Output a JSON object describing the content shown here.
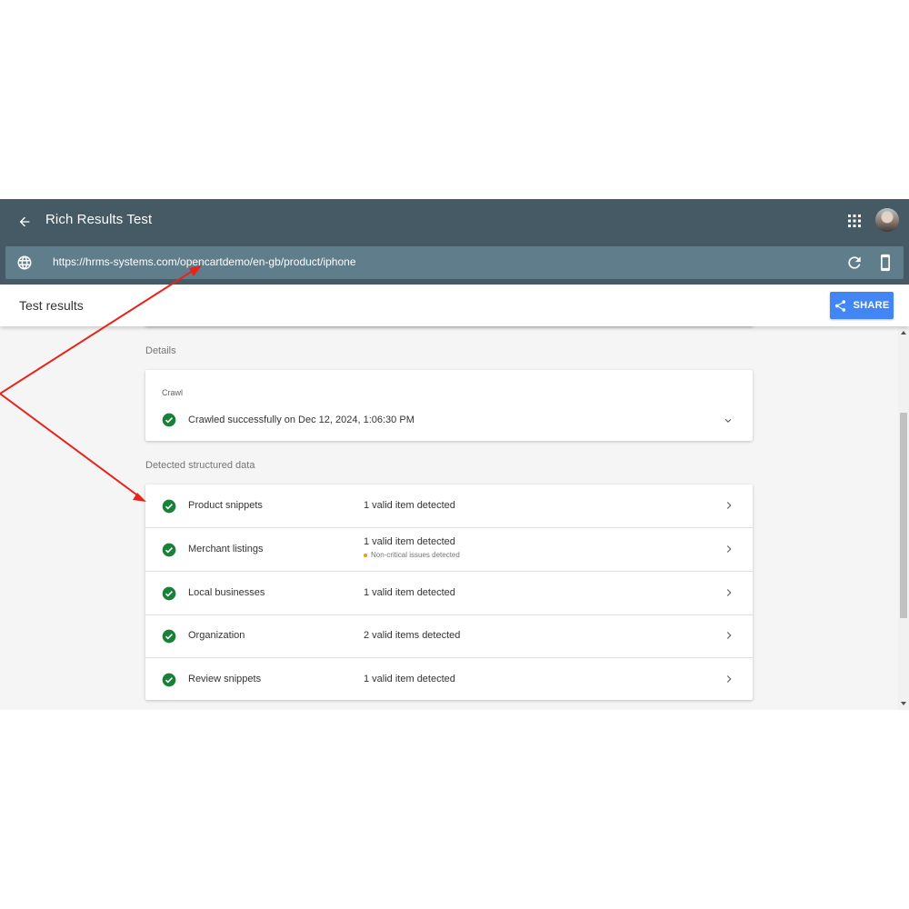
{
  "header": {
    "title": "Rich Results Test",
    "url": "https://hrms-systems.com/opencartdemo/en-gb/product/iphone"
  },
  "results_bar": {
    "title": "Test results",
    "share_label": "SHARE"
  },
  "details": {
    "section_label": "Details",
    "crawl_label": "Crawl",
    "crawl_status": "Crawled successfully on Dec 12, 2024, 1:06:30 PM"
  },
  "structured_data": {
    "section_label": "Detected structured data",
    "items": [
      {
        "name": "Product snippets",
        "status": "1 valid item detected",
        "warning": ""
      },
      {
        "name": "Merchant listings",
        "status": "1 valid item detected",
        "warning": "Non-critical issues detected"
      },
      {
        "name": "Local businesses",
        "status": "1 valid item detected",
        "warning": ""
      },
      {
        "name": "Organization",
        "status": "2 valid items detected",
        "warning": ""
      },
      {
        "name": "Review snippets",
        "status": "1 valid item detected",
        "warning": ""
      }
    ]
  },
  "colors": {
    "header_bg": "#455a64",
    "url_bar_bg": "#607d8b",
    "share_button": "#4285f4",
    "valid_check": "#188038",
    "warning_dot": "#f29900",
    "annotation_arrow": "#e8231a"
  },
  "icons": [
    "back-arrow-icon",
    "apps-grid-icon",
    "globe-icon",
    "refresh-icon",
    "smartphone-icon",
    "share-icon",
    "check-circle-icon",
    "chevron-down-icon",
    "chevron-right-icon"
  ]
}
